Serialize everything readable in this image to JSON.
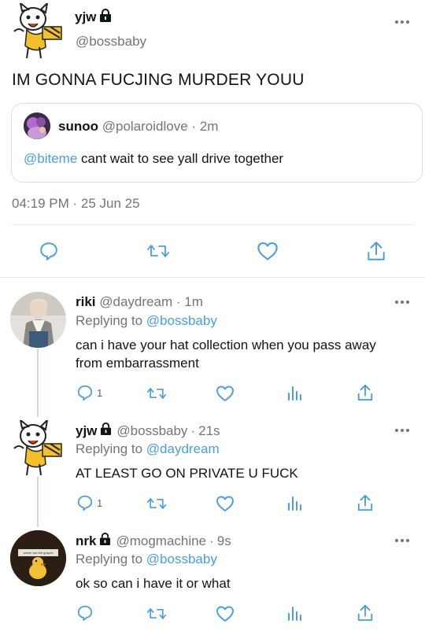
{
  "main_tweet": {
    "name": "yjw",
    "handle": "@bossbaby",
    "text": "IM GONNA FUCJING MURDER YOUU",
    "timestamp": "04:19 PM · 25 Jun 25"
  },
  "quoted_tweet": {
    "name": "sunoo",
    "handle": "@polaroidlove",
    "sep": "·",
    "time": "2m",
    "mention": "@biteme",
    "text": "cant wait to see yall drive together"
  },
  "replies": [
    {
      "name": "riki",
      "handle": "@daydream",
      "time": "1m",
      "replying_to_label": "Replying to",
      "replying_to": "@bossbaby",
      "text": "can i have your hat collection when you pass away from embarrassment",
      "reply_count": "1"
    },
    {
      "name": "yjw",
      "handle": "@bossbaby",
      "time": "21s",
      "replying_to_label": "Replying to",
      "replying_to": "@daydream",
      "text": "AT LEAST GO ON PRIVATE U FUCK",
      "reply_count": "1"
    },
    {
      "name": "nrk",
      "handle": "@mogmachine",
      "time": "9s",
      "replying_to_label": "Replying to",
      "replying_to": "@bossbaby",
      "text": "ok so can i have it or what",
      "reply_count": "",
      "avatar_caption": "where are the grapes"
    }
  ],
  "colors": {
    "link": "#4a9de0",
    "muted": "#6e767d",
    "divider": "#e5e9ec"
  },
  "icons": [
    "lock-icon",
    "more-icon",
    "reply-icon",
    "retweet-icon",
    "like-icon",
    "share-icon",
    "analytics-icon"
  ]
}
